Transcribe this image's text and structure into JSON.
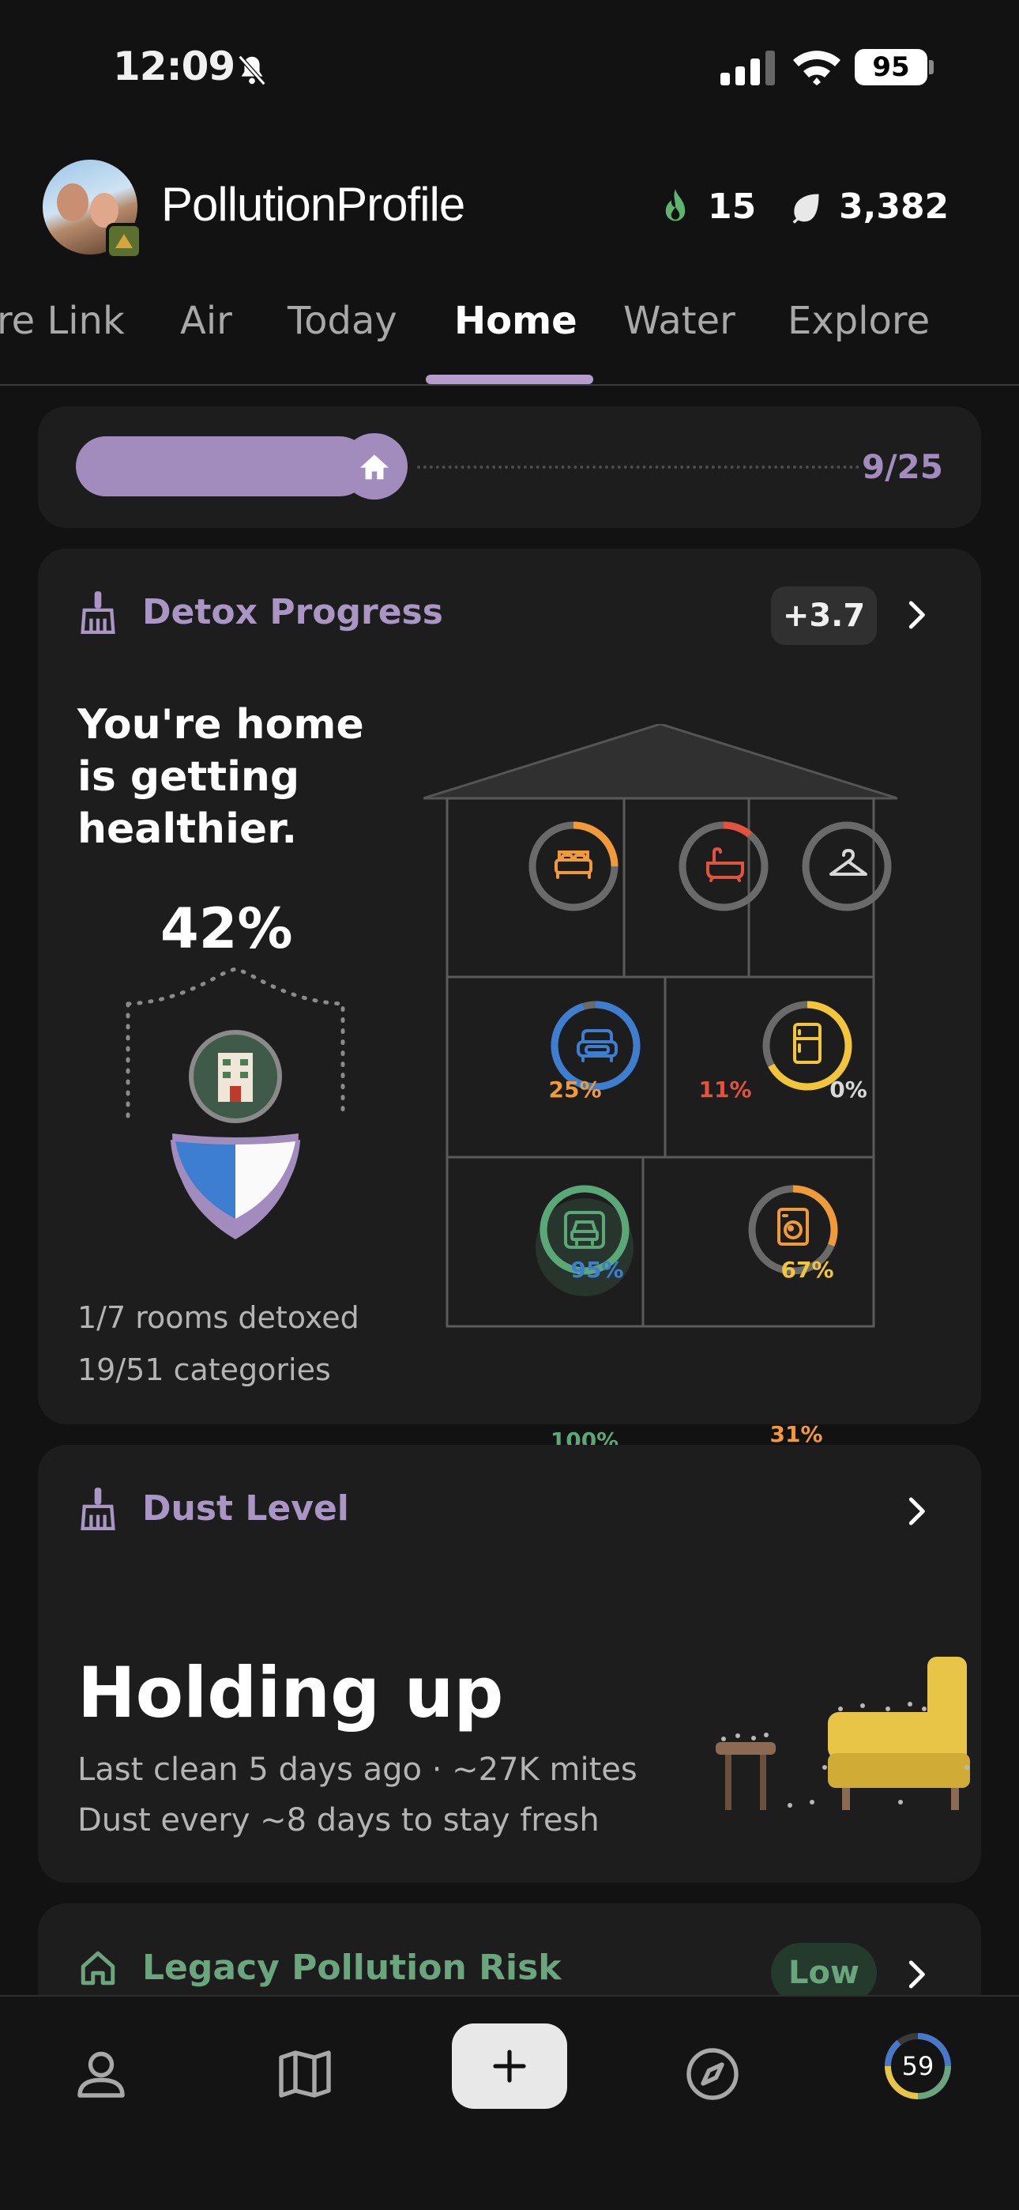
{
  "status_bar": {
    "time": "12:09",
    "battery": "95"
  },
  "header": {
    "app_title": "PollutionProfile",
    "streak_count": "15",
    "leaf_count": "3,382"
  },
  "tabs": [
    {
      "label": "re Link"
    },
    {
      "label": "Air"
    },
    {
      "label": "Today"
    },
    {
      "label": "Home",
      "active": true
    },
    {
      "label": "Water"
    },
    {
      "label": "Explore"
    }
  ],
  "progress": {
    "count_label": "9/25",
    "value": 0.36,
    "color": "#a28cbd"
  },
  "detox": {
    "title": "Detox Progress",
    "delta": "+3.7",
    "headline": "You're home is getting healthier.",
    "percent": "42%",
    "rooms_detoxed": "1/7 rooms detoxed",
    "categories": "19/51 categories",
    "rooms": [
      {
        "icon": "bed-icon",
        "percent": "25%",
        "value": 0.25,
        "color": "#f09a3a"
      },
      {
        "icon": "bathtub-icon",
        "percent": "11%",
        "value": 0.11,
        "color": "#e0533e"
      },
      {
        "icon": "hanger-icon",
        "percent": "0%",
        "value": 0,
        "color": "#d8d8d8"
      },
      {
        "icon": "sofa-icon",
        "percent": "95%",
        "value": 0.95,
        "color": "#3d7ed0"
      },
      {
        "icon": "fridge-icon",
        "percent": "67%",
        "value": 0.67,
        "color": "#f2c53a"
      },
      {
        "icon": "car-icon",
        "percent": "100%",
        "value": 1.0,
        "color": "#5aa878"
      },
      {
        "icon": "washer-icon",
        "percent": "31%",
        "value": 0.31,
        "color": "#f09a3a"
      }
    ]
  },
  "dust": {
    "title": "Dust Level",
    "status": "Holding up",
    "line1": "Last clean 5 days ago · ~27K mites",
    "line2": "Dust every ~8 days to stay fresh"
  },
  "legacy": {
    "title": "Legacy Pollution Risk",
    "badge": "Low"
  },
  "bottom_nav": {
    "score": "59"
  },
  "colors": {
    "accent": "#a28cbd",
    "background": "#121212",
    "card": "#1d1d1d",
    "green": "#6aa57e"
  }
}
